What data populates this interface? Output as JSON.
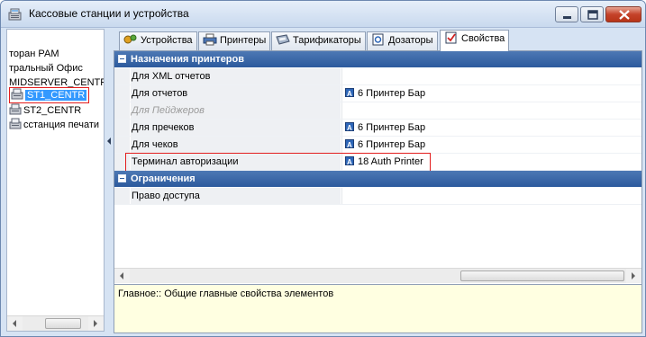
{
  "window": {
    "title": "Кассовые станции и устройства",
    "icon": "cash-register-icon"
  },
  "tree": {
    "items": [
      {
        "label": "торан РАМ",
        "icon": null
      },
      {
        "label": "тральный Офис",
        "icon": null
      },
      {
        "label": "MIDSERVER_CENTR",
        "icon": null
      },
      {
        "label": "ST1_CENTR",
        "icon": "cash-register-icon",
        "selected": true
      },
      {
        "label": "ST2_CENTR",
        "icon": "cash-register-icon"
      },
      {
        "label": "сстанция печати",
        "icon": "cash-register-icon"
      }
    ]
  },
  "tabs": [
    {
      "label": "Устройства",
      "icon": "devices-icon"
    },
    {
      "label": "Принтеры",
      "icon": "printer-icon"
    },
    {
      "label": "Тарификаторы",
      "icon": "tariffer-icon"
    },
    {
      "label": "Дозаторы",
      "icon": "dispenser-icon"
    },
    {
      "label": "Свойства",
      "icon": "properties-icon",
      "active": true
    }
  ],
  "grid": {
    "cat1": "Назначения принтеров",
    "rows": [
      {
        "label": "Для XML отчетов",
        "value": ""
      },
      {
        "label": "Для отчетов",
        "value": "6 Принтер Бар"
      },
      {
        "label": "Для Пейджеров",
        "value": "",
        "disabled": true
      },
      {
        "label": "Для пречеков",
        "value": "6 Принтер Бар"
      },
      {
        "label": "Для чеков",
        "value": "6 Принтер Бар"
      },
      {
        "label": "Терминал авторизации",
        "value": "18 Auth Printer"
      }
    ],
    "cat2": "Ограничения",
    "rows2": [
      {
        "label": "Право доступа",
        "value": ""
      }
    ]
  },
  "description": "Главное:: Общие главные свойства элементов",
  "colors": {
    "category": "#2c5a9d",
    "selection": "#3399ff",
    "highlight": "#e31d1d",
    "description_bg": "#ffffe1"
  }
}
